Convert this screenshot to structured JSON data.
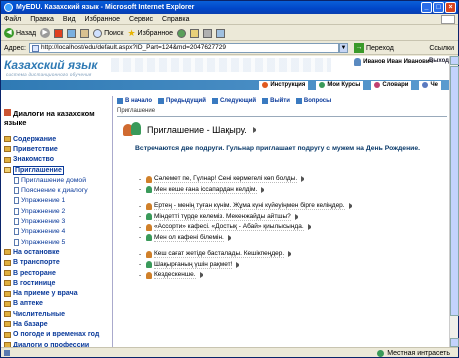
{
  "window": {
    "title": "MyEDU. Казахский язык - Microsoft Internet Explorer",
    "controls": [
      "_",
      "□",
      "×"
    ]
  },
  "menu": [
    "Файл",
    "Правка",
    "Вид",
    "Избранное",
    "Сервис",
    "Справка"
  ],
  "toolbar": {
    "back": "Назад",
    "search": "Поиск",
    "favorites": "Избранное"
  },
  "address": {
    "label": "Адрес:",
    "url": "http://localhost/edu/default.aspx?ID_Part=124&md=2047627729",
    "go": "Переход",
    "links": "Ссылки"
  },
  "banner": {
    "logo": "Казахский язык",
    "subtitle": "система дистанционного обучения",
    "user": "Иванов Иван Иванович",
    "exit": "Выход",
    "nav": [
      "Инструкция",
      "Мои Курсы",
      "Словари",
      "Че"
    ]
  },
  "sidebar": {
    "title": "Диалоги на казахском языке",
    "items": [
      {
        "label": "Содержание",
        "level": 0
      },
      {
        "label": "Приветствие",
        "level": 0
      },
      {
        "label": "Знакомство",
        "level": 0
      },
      {
        "label": "Приглашение",
        "level": 0,
        "active": true
      },
      {
        "label": "Приглашение домой",
        "level": 1
      },
      {
        "label": "Пояснение к диалогу",
        "level": 1
      },
      {
        "label": "Упражнение 1",
        "level": 1
      },
      {
        "label": "Упражнение 2",
        "level": 1
      },
      {
        "label": "Упражнение 3",
        "level": 1
      },
      {
        "label": "Упражнение 4",
        "level": 1
      },
      {
        "label": "Упражнение 5",
        "level": 1
      },
      {
        "label": "На остановке",
        "level": 0
      },
      {
        "label": "В транспорте",
        "level": 0
      },
      {
        "label": "В ресторане",
        "level": 0
      },
      {
        "label": "В гостинице",
        "level": 0
      },
      {
        "label": "На приеме у врача",
        "level": 0
      },
      {
        "label": "В аптеке",
        "level": 0
      },
      {
        "label": "Числительные",
        "level": 0
      },
      {
        "label": "На базаре",
        "level": 0
      },
      {
        "label": "О погоде и временах год",
        "level": 0
      },
      {
        "label": "Диалоги о профессии",
        "level": 0
      }
    ]
  },
  "main": {
    "nav": [
      "В начало",
      "Предыдущий",
      "Следующий",
      "Выйти",
      "Вопросы"
    ],
    "breadcrumb": "Приглашение",
    "lesson_title": "Приглашение - Шақыру.",
    "intro": "Встречаются две подруги. Гульнар приглашает подругу с мужем на День Рождение.",
    "dialogue": [
      {
        "speaker": "a",
        "text": "Сәлемет пе, Гүлнар! Сені көрмегелі көп болды."
      },
      {
        "speaker": "b",
        "text": "Мен кеше ғана іссапардан келдім."
      },
      {
        "speaker": null,
        "text": ""
      },
      {
        "speaker": "a",
        "text": "Ертең - менің туған күнім. Жұма күні күйеуіңмен бірге келіңдер."
      },
      {
        "speaker": "b",
        "text": "Міндетті түрде келеміз. Мекенжайды айтшы?"
      },
      {
        "speaker": "a",
        "text": "«Ассорти» кафесі. «Достық - Абай» қиылысында."
      },
      {
        "speaker": "b",
        "text": "Мен ол кафені білемін."
      },
      {
        "speaker": null,
        "text": ""
      },
      {
        "speaker": "a",
        "text": "Кеш сағат жетіде басталады. Кешікпеңдер."
      },
      {
        "speaker": "b",
        "text": "Шақырғаның үшін рақмет!"
      },
      {
        "speaker": "a",
        "text": "Кездескенше."
      }
    ]
  },
  "status": {
    "left": "",
    "right": "Местная интрасеть"
  }
}
